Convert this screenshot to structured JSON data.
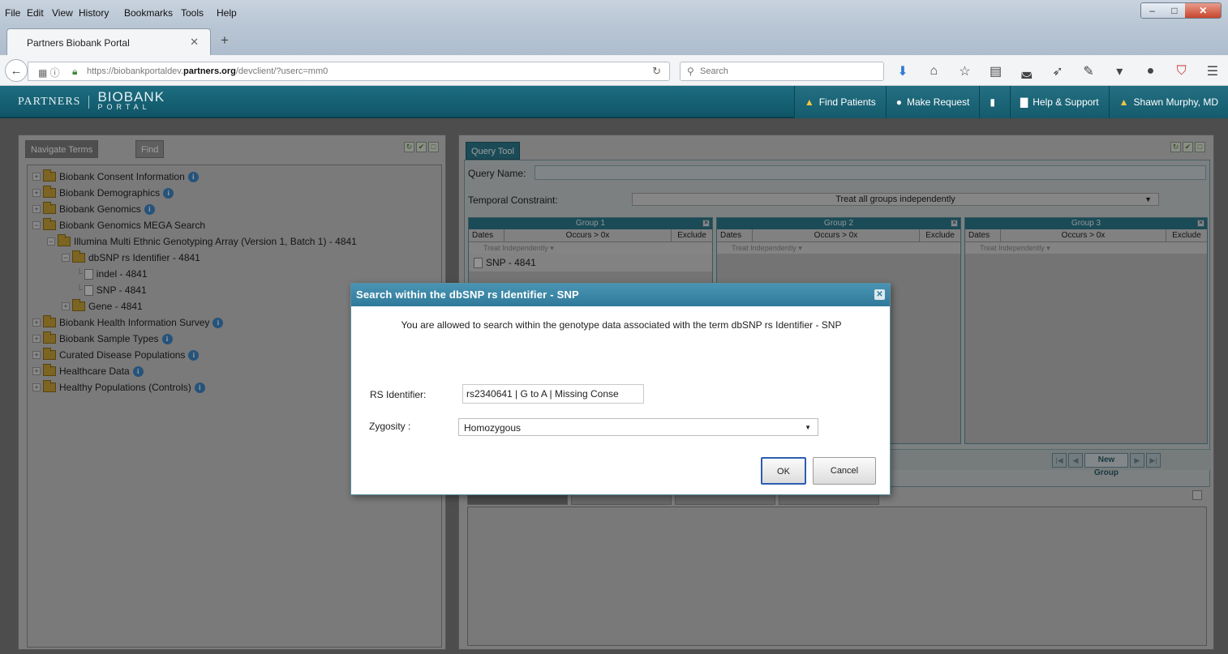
{
  "browser": {
    "menu": [
      "File",
      "Edit",
      "View",
      "History",
      "Bookmarks",
      "Tools",
      "Help"
    ],
    "tab_title": "Partners Biobank Portal",
    "url_prefix": "https://biobankportaldev.",
    "url_domain": "partners.org",
    "url_path": "/devclient/?userc=mm0",
    "search_placeholder": "Search"
  },
  "app": {
    "logo_left": "PARTNERS",
    "logo_right_top": "BIOBANK",
    "logo_right_bottom": "PORTAL",
    "nav": [
      {
        "label": "Find Patients"
      },
      {
        "label": "Make Request"
      },
      {
        "label": ""
      },
      {
        "label": "Help & Support"
      },
      {
        "label": "Shawn Murphy, MD"
      }
    ]
  },
  "left_panel": {
    "tabs": [
      "Navigate Terms",
      "Find"
    ],
    "tree": [
      {
        "label": "Biobank Consent Information"
      },
      {
        "label": "Biobank Demographics"
      },
      {
        "label": "Biobank Genomics"
      },
      {
        "label": "Biobank Genomics MEGA Search"
      },
      {
        "label": "Illumina Multi Ethnic Genotyping Array (Version 1, Batch 1) - 4841"
      },
      {
        "label": "dbSNP rs Identifier - 4841"
      },
      {
        "label": "indel - 4841"
      },
      {
        "label": "SNP - 4841"
      },
      {
        "label": "Gene - 4841"
      },
      {
        "label": "Biobank Health Information Survey"
      },
      {
        "label": "Biobank Sample Types"
      },
      {
        "label": "Curated Disease Populations"
      },
      {
        "label": "Healthcare Data"
      },
      {
        "label": "Healthy Populations (Controls)"
      }
    ]
  },
  "query_tool": {
    "tab": "Query Tool",
    "query_name_label": "Query Name:",
    "temporal_label": "Temporal Constraint:",
    "temporal_value": "Treat all groups independently",
    "groups": [
      {
        "name": "Group 1",
        "dates": "Dates",
        "occurs": "Occurs > 0x",
        "exclude": "Exclude",
        "item": "SNP - 4841"
      },
      {
        "name": "Group 2",
        "dates": "Dates",
        "occurs": "Occurs > 0x",
        "exclude": "Exclude",
        "item": ""
      },
      {
        "name": "Group 3",
        "dates": "Dates",
        "occurs": "Occurs > 0x",
        "exclude": "Exclude",
        "item": ""
      }
    ],
    "group_sub": "Treat Independently",
    "new_group": "New Group"
  },
  "dialog": {
    "title": "Search within the dbSNP rs Identifier - SNP",
    "message": "You are allowed to search within the genotype data associated with the term dbSNP rs Identifier - SNP",
    "rs_label": "RS Identifier:",
    "rs_value": "rs2340641 | G to A | Missing Conse",
    "zygosity_label": "Zygosity :",
    "zygosity_value": "Homozygous",
    "ok": "OK",
    "cancel": "Cancel"
  }
}
